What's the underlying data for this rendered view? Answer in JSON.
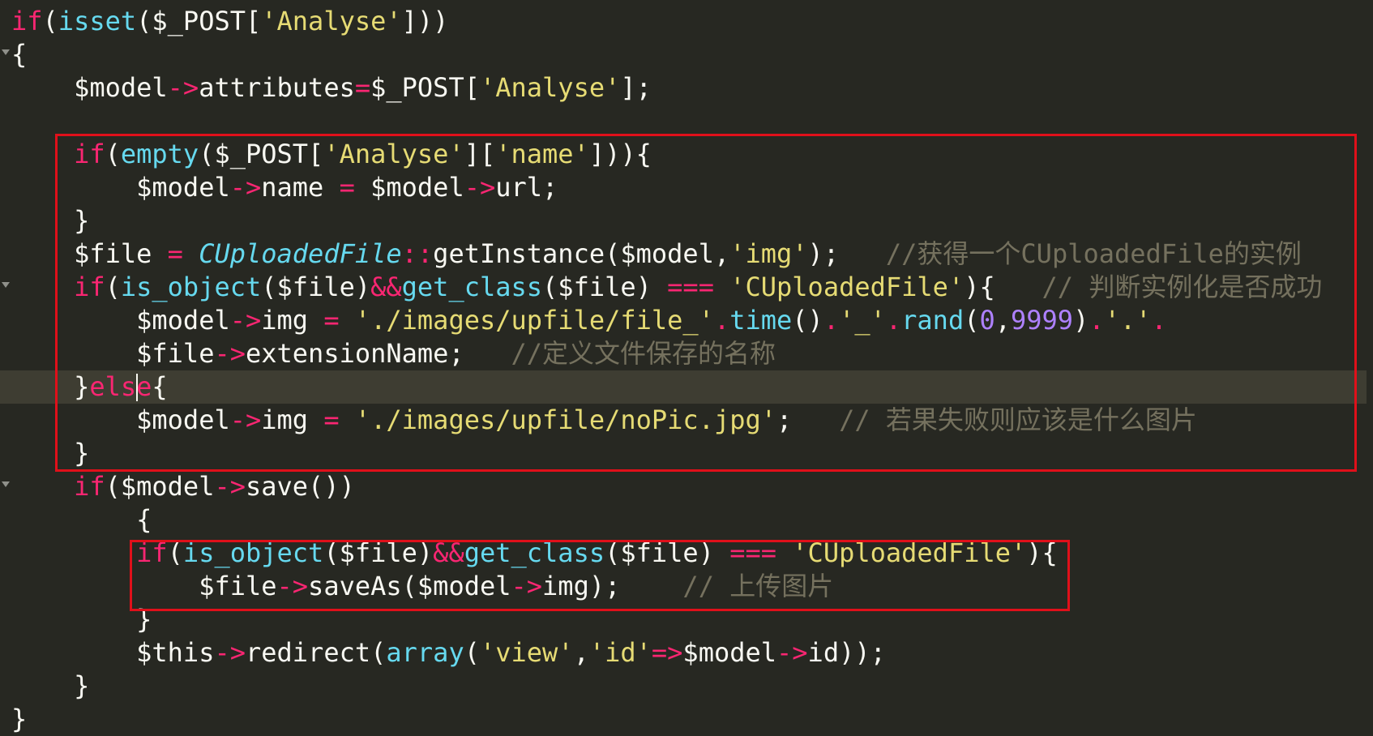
{
  "editor": {
    "theme_colors": {
      "background": "#272822",
      "keyword": "#f92672",
      "function": "#66d9ef",
      "string": "#e6db74",
      "number": "#ae81ff",
      "comment": "#75715e",
      "text": "#f8f8f2",
      "highlight_box": "#e0101a"
    },
    "active_line": 11,
    "lines": [
      {
        "fold": false,
        "tokens": [
          {
            "t": "kw",
            "v": "if"
          },
          {
            "t": "txt",
            "v": "("
          },
          {
            "t": "fn",
            "v": "isset"
          },
          {
            "t": "txt",
            "v": "($_POST["
          },
          {
            "t": "str",
            "v": "'Analyse'"
          },
          {
            "t": "txt",
            "v": "]))"
          }
        ]
      },
      {
        "fold": true,
        "tokens": [
          {
            "t": "txt",
            "v": "{"
          }
        ]
      },
      {
        "fold": false,
        "tokens": [
          {
            "t": "txt",
            "v": "    $model"
          },
          {
            "t": "op",
            "v": "->"
          },
          {
            "t": "txt",
            "v": "attributes"
          },
          {
            "t": "op",
            "v": "="
          },
          {
            "t": "txt",
            "v": "$_POST["
          },
          {
            "t": "str",
            "v": "'Analyse'"
          },
          {
            "t": "txt",
            "v": "];"
          }
        ]
      },
      {
        "fold": false,
        "tokens": []
      },
      {
        "fold": false,
        "tokens": [
          {
            "t": "txt",
            "v": "    "
          },
          {
            "t": "kw",
            "v": "if"
          },
          {
            "t": "txt",
            "v": "("
          },
          {
            "t": "fn",
            "v": "empty"
          },
          {
            "t": "txt",
            "v": "($_POST["
          },
          {
            "t": "str",
            "v": "'Analyse'"
          },
          {
            "t": "txt",
            "v": "]["
          },
          {
            "t": "str",
            "v": "'name'"
          },
          {
            "t": "txt",
            "v": "])){"
          }
        ]
      },
      {
        "fold": false,
        "tokens": [
          {
            "t": "txt",
            "v": "        $model"
          },
          {
            "t": "op",
            "v": "->"
          },
          {
            "t": "txt",
            "v": "name "
          },
          {
            "t": "op",
            "v": "="
          },
          {
            "t": "txt",
            "v": " $model"
          },
          {
            "t": "op",
            "v": "->"
          },
          {
            "t": "txt",
            "v": "url;"
          }
        ]
      },
      {
        "fold": false,
        "tokens": [
          {
            "t": "txt",
            "v": "    }"
          }
        ]
      },
      {
        "fold": false,
        "tokens": [
          {
            "t": "txt",
            "v": "    $file "
          },
          {
            "t": "op",
            "v": "="
          },
          {
            "t": "txt",
            "v": " "
          },
          {
            "t": "cls",
            "v": "CUploadedFile"
          },
          {
            "t": "op",
            "v": "::"
          },
          {
            "t": "txt",
            "v": "getInstance($model,"
          },
          {
            "t": "str",
            "v": "'img'"
          },
          {
            "t": "txt",
            "v": ");   "
          },
          {
            "t": "cm",
            "v": "//获得一个CUploadedFile的实例"
          }
        ]
      },
      {
        "fold": true,
        "tokens": [
          {
            "t": "txt",
            "v": "    "
          },
          {
            "t": "kw",
            "v": "if"
          },
          {
            "t": "txt",
            "v": "("
          },
          {
            "t": "fn",
            "v": "is_object"
          },
          {
            "t": "txt",
            "v": "($file)"
          },
          {
            "t": "op",
            "v": "&&"
          },
          {
            "t": "fn",
            "v": "get_class"
          },
          {
            "t": "txt",
            "v": "($file) "
          },
          {
            "t": "op",
            "v": "==="
          },
          {
            "t": "txt",
            "v": " "
          },
          {
            "t": "str",
            "v": "'CUploadedFile'"
          },
          {
            "t": "txt",
            "v": "){   "
          },
          {
            "t": "cm",
            "v": "// 判断实例化是否成功"
          }
        ]
      },
      {
        "fold": false,
        "tokens": [
          {
            "t": "txt",
            "v": "        $model"
          },
          {
            "t": "op",
            "v": "->"
          },
          {
            "t": "txt",
            "v": "img "
          },
          {
            "t": "op",
            "v": "="
          },
          {
            "t": "txt",
            "v": " "
          },
          {
            "t": "str",
            "v": "'./images/upfile/file_'"
          },
          {
            "t": "op",
            "v": "."
          },
          {
            "t": "fn",
            "v": "time"
          },
          {
            "t": "txt",
            "v": "()"
          },
          {
            "t": "op",
            "v": "."
          },
          {
            "t": "str",
            "v": "'_'"
          },
          {
            "t": "op",
            "v": "."
          },
          {
            "t": "fn",
            "v": "rand"
          },
          {
            "t": "txt",
            "v": "("
          },
          {
            "t": "num",
            "v": "0"
          },
          {
            "t": "txt",
            "v": ","
          },
          {
            "t": "num",
            "v": "9999"
          },
          {
            "t": "txt",
            "v": ")"
          },
          {
            "t": "op",
            "v": "."
          },
          {
            "t": "str",
            "v": "'.'"
          },
          {
            "t": "op",
            "v": "."
          }
        ]
      },
      {
        "fold": false,
        "tokens": [
          {
            "t": "txt",
            "v": "        $file"
          },
          {
            "t": "op",
            "v": "->"
          },
          {
            "t": "txt",
            "v": "extensionName;   "
          },
          {
            "t": "cm",
            "v": "//定义文件保存的名称"
          }
        ]
      },
      {
        "fold": false,
        "tokens": [
          {
            "t": "txt",
            "v": "    }"
          },
          {
            "t": "kw",
            "v": "else"
          },
          {
            "t": "txt",
            "v": "{"
          }
        ]
      },
      {
        "fold": false,
        "tokens": [
          {
            "t": "txt",
            "v": "        $model"
          },
          {
            "t": "op",
            "v": "->"
          },
          {
            "t": "txt",
            "v": "img "
          },
          {
            "t": "op",
            "v": "="
          },
          {
            "t": "txt",
            "v": " "
          },
          {
            "t": "str",
            "v": "'./images/upfile/noPic.jpg'"
          },
          {
            "t": "txt",
            "v": ";   "
          },
          {
            "t": "cm",
            "v": "// 若果失败则应该是什么图片"
          }
        ]
      },
      {
        "fold": false,
        "tokens": [
          {
            "t": "txt",
            "v": "    }"
          }
        ]
      },
      {
        "fold": true,
        "tokens": [
          {
            "t": "txt",
            "v": "    "
          },
          {
            "t": "kw",
            "v": "if"
          },
          {
            "t": "txt",
            "v": "($model"
          },
          {
            "t": "op",
            "v": "->"
          },
          {
            "t": "txt",
            "v": "save())"
          }
        ]
      },
      {
        "fold": false,
        "tokens": [
          {
            "t": "txt",
            "v": "        {"
          }
        ]
      },
      {
        "fold": false,
        "tokens": [
          {
            "t": "txt",
            "v": "        "
          },
          {
            "t": "kw",
            "v": "if"
          },
          {
            "t": "txt",
            "v": "("
          },
          {
            "t": "fn",
            "v": "is_object"
          },
          {
            "t": "txt",
            "v": "($file)"
          },
          {
            "t": "op",
            "v": "&&"
          },
          {
            "t": "fn",
            "v": "get_class"
          },
          {
            "t": "txt",
            "v": "($file) "
          },
          {
            "t": "op",
            "v": "==="
          },
          {
            "t": "txt",
            "v": " "
          },
          {
            "t": "str",
            "v": "'CUploadedFile'"
          },
          {
            "t": "txt",
            "v": "){"
          }
        ]
      },
      {
        "fold": false,
        "tokens": [
          {
            "t": "txt",
            "v": "            $file"
          },
          {
            "t": "op",
            "v": "->"
          },
          {
            "t": "txt",
            "v": "saveAs($model"
          },
          {
            "t": "op",
            "v": "->"
          },
          {
            "t": "txt",
            "v": "img);    "
          },
          {
            "t": "cm",
            "v": "// 上传图片"
          }
        ]
      },
      {
        "fold": false,
        "tokens": [
          {
            "t": "txt",
            "v": "        }"
          }
        ]
      },
      {
        "fold": false,
        "tokens": [
          {
            "t": "txt",
            "v": "        $this"
          },
          {
            "t": "op",
            "v": "->"
          },
          {
            "t": "txt",
            "v": "redirect("
          },
          {
            "t": "fn",
            "v": "array"
          },
          {
            "t": "txt",
            "v": "("
          },
          {
            "t": "str",
            "v": "'view'"
          },
          {
            "t": "txt",
            "v": ","
          },
          {
            "t": "str",
            "v": "'id'"
          },
          {
            "t": "op",
            "v": "=>"
          },
          {
            "t": "txt",
            "v": "$model"
          },
          {
            "t": "op",
            "v": "->"
          },
          {
            "t": "txt",
            "v": "id));"
          }
        ]
      },
      {
        "fold": false,
        "tokens": [
          {
            "t": "txt",
            "v": "    }"
          }
        ]
      },
      {
        "fold": false,
        "tokens": [
          {
            "t": "txt",
            "v": "}"
          }
        ]
      }
    ]
  }
}
